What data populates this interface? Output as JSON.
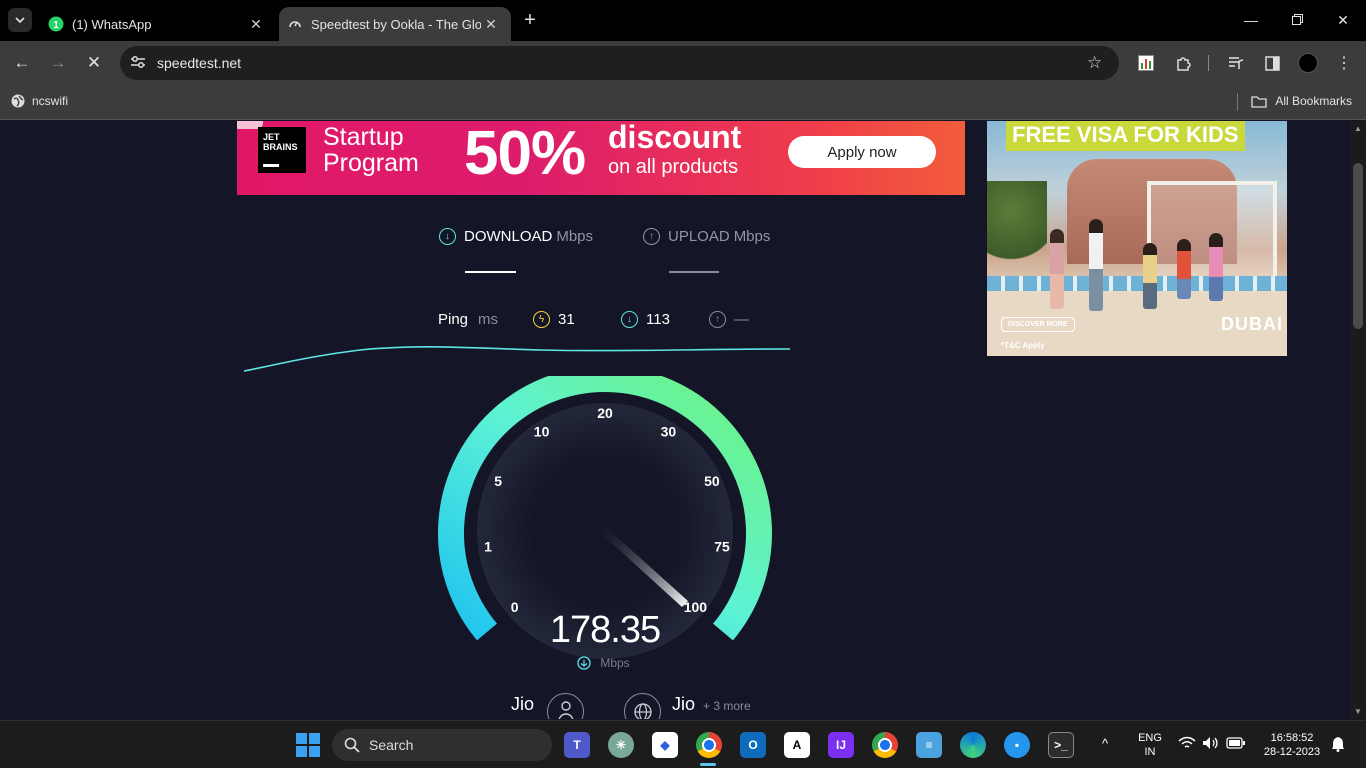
{
  "browser": {
    "tabs": [
      {
        "title": "(1) WhatsApp",
        "active": false
      },
      {
        "title": "Speedtest by Ookla - The Global Broadband Speed Test",
        "active": true
      }
    ],
    "url": "speedtest.net",
    "bookmarks": [
      {
        "label": "ncswifi"
      }
    ],
    "all_bookmarks_label": "All Bookmarks"
  },
  "ads": {
    "jetbrains": {
      "logo_text": "JET\nBRAINS",
      "line1": "Startup",
      "line2": "Program",
      "percent": "50%",
      "discount": "discount",
      "sub": "on all products",
      "cta": "Apply now"
    },
    "dubai": {
      "headline": "FREE VISA FOR KIDS",
      "cta": "DISCOVER MORE",
      "terms": "*T&C Apply",
      "brand": "DUBAI"
    }
  },
  "speedtest": {
    "download_label": "DOWNLOAD",
    "upload_label": "UPLOAD",
    "unit": "Mbps",
    "ping_label": "Ping",
    "ping_unit": "ms",
    "ping_idle": "31",
    "ping_download": "113",
    "ping_upload": "—",
    "gauge_ticks": [
      "0",
      "1",
      "5",
      "10",
      "20",
      "30",
      "50",
      "75",
      "100"
    ],
    "current_speed": "178.35",
    "speed_unit": "Mbps",
    "isp": "Jio",
    "server": "Jio",
    "server_more": "+ 3 more",
    "colors": {
      "accent_cyan": "#5ee6e7",
      "gauge_green": "#6ef37a",
      "gauge_blue": "#1ec3f0",
      "background": "#141526"
    }
  },
  "taskbar": {
    "search_placeholder": "Search",
    "lang_top": "ENG",
    "lang_bottom": "IN",
    "time": "16:58:52",
    "date": "28-12-2023",
    "apps": [
      "windows-start-icon",
      "teams-icon",
      "chatgpt-icon",
      "signal-icon",
      "chrome-icon",
      "outlook-icon",
      "notion-icon",
      "intellij-icon",
      "chrome-alt-icon",
      "notepad-icon",
      "edge-icon",
      "docker-icon",
      "terminal-icon"
    ]
  }
}
